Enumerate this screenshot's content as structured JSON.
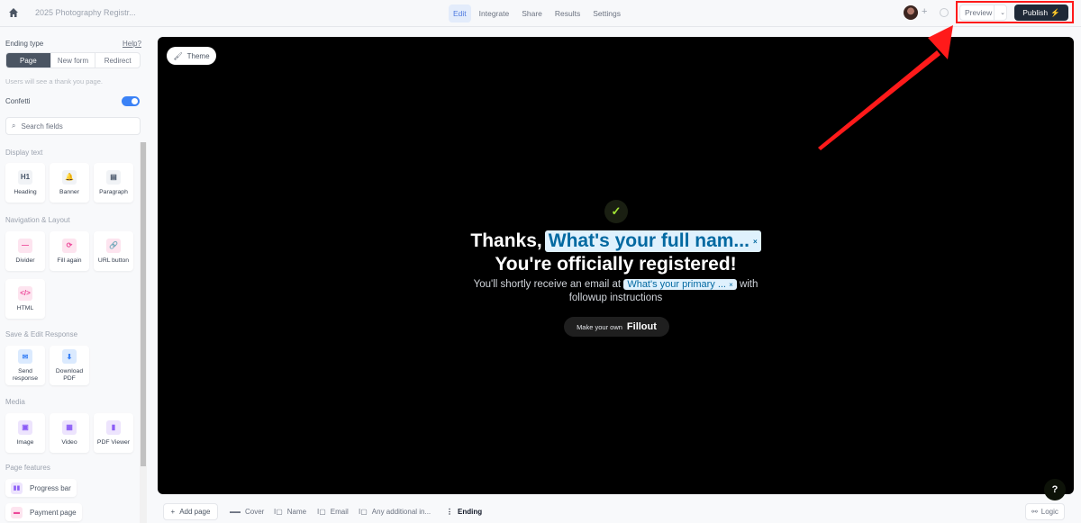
{
  "topbar": {
    "form_title": "2025 Photography Registr...",
    "tabs": [
      {
        "label": "Edit",
        "active": true
      },
      {
        "label": "Integrate"
      },
      {
        "label": "Share"
      },
      {
        "label": "Results"
      },
      {
        "label": "Settings"
      }
    ],
    "preview_label": "Preview",
    "publish_label": "Publish",
    "icons": {
      "home": "home-icon",
      "add_collaborator": "plus-icon",
      "history": "clock-icon",
      "publish": "lightning-icon"
    }
  },
  "sidebar": {
    "ending_type_label": "Ending type",
    "help_label": "Help?",
    "ending_options": [
      {
        "label": "Page",
        "selected": true
      },
      {
        "label": "New form"
      },
      {
        "label": "Redirect"
      }
    ],
    "hint": "Users will see a thank you page.",
    "confetti_label": "Confetti",
    "confetti_on": true,
    "search_placeholder": "Search fields",
    "sections": [
      {
        "title": "Display text",
        "items": [
          {
            "label": "Heading",
            "icon": "H1"
          },
          {
            "label": "Banner",
            "icon": "🔔"
          },
          {
            "label": "Paragraph",
            "icon": "▤"
          }
        ]
      },
      {
        "title": "Navigation & Layout",
        "items": [
          {
            "label": "Divider",
            "icon": "—"
          },
          {
            "label": "Fill again",
            "icon": "⟳"
          },
          {
            "label": "URL button",
            "icon": "🔗"
          },
          {
            "label": "HTML",
            "icon": "</>"
          }
        ]
      },
      {
        "title": "Save & Edit Response",
        "items": [
          {
            "label": "Send response",
            "icon": "✉"
          },
          {
            "label": "Download PDF",
            "icon": "⬇"
          }
        ]
      },
      {
        "title": "Media",
        "items": [
          {
            "label": "Image",
            "icon": "▣"
          },
          {
            "label": "Video",
            "icon": "▦"
          },
          {
            "label": "PDF Viewer",
            "icon": "▮"
          }
        ]
      },
      {
        "title": "Page features",
        "items": [
          {
            "label": "Progress bar",
            "icon": "▮▮"
          },
          {
            "label": "Payment page",
            "icon": "▬"
          }
        ]
      }
    ]
  },
  "canvas": {
    "theme_label": "Theme",
    "thanks_prefix": "Thanks,",
    "name_chip": "What's your full nam...",
    "headline2": "You're officially registered!",
    "sub_prefix": "You'll shortly receive an email at",
    "email_chip": "What's your primary ...",
    "sub_suffix": "with",
    "sub_line2": "followup instructions",
    "made_prefix": "Make your own",
    "made_brand": "Fillout",
    "chip_close": "×",
    "help_glyph": "?"
  },
  "bottombar": {
    "add_page_label": "Add page",
    "pages": [
      {
        "label": "Cover",
        "icon": "▬▬"
      },
      {
        "label": "Name",
        "icon": "I▢"
      },
      {
        "label": "Email",
        "icon": "I▢"
      },
      {
        "label": "Any additional in...",
        "icon": "I▢"
      },
      {
        "label": "Ending",
        "icon": "⋮",
        "active": true
      }
    ],
    "logic_label": "Logic"
  },
  "colors": {
    "accent": "#3b82f6",
    "publish_bg": "#1f2937",
    "annotation": "#ff1a1a",
    "chip_bg": "#dff1fd",
    "chip_text": "#0369a1"
  }
}
